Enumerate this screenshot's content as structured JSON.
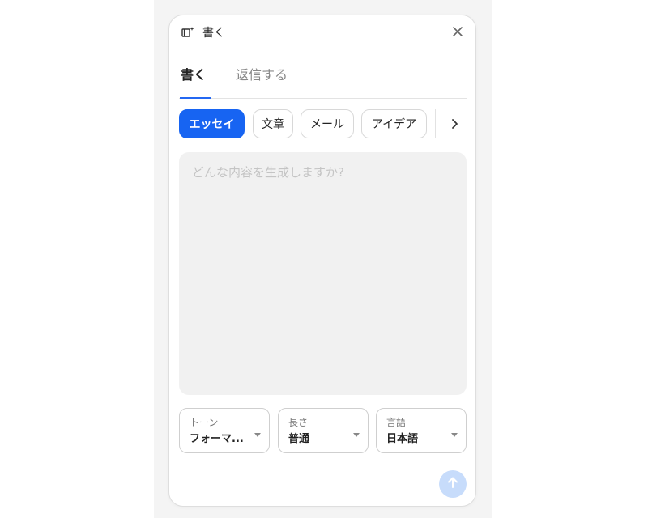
{
  "header": {
    "title": "書く",
    "icon": "write-sparkle-icon",
    "close_icon": "close-icon"
  },
  "tabs": [
    {
      "label": "書く",
      "active": true
    },
    {
      "label": "返信する",
      "active": false
    }
  ],
  "chips": [
    {
      "label": "エッセイ",
      "active": true
    },
    {
      "label": "文章",
      "active": false
    },
    {
      "label": "メール",
      "active": false
    },
    {
      "label": "アイデア",
      "active": false
    }
  ],
  "prompt": {
    "placeholder": "どんな内容を生成しますか?",
    "value": ""
  },
  "options": {
    "tone": {
      "label": "トーン",
      "value": "フォーマ..."
    },
    "length": {
      "label": "長さ",
      "value": "普通"
    },
    "language": {
      "label": "言語",
      "value": "日本語"
    }
  },
  "colors": {
    "accent": "#1764f2",
    "send_disabled": "#c7dcfb"
  }
}
